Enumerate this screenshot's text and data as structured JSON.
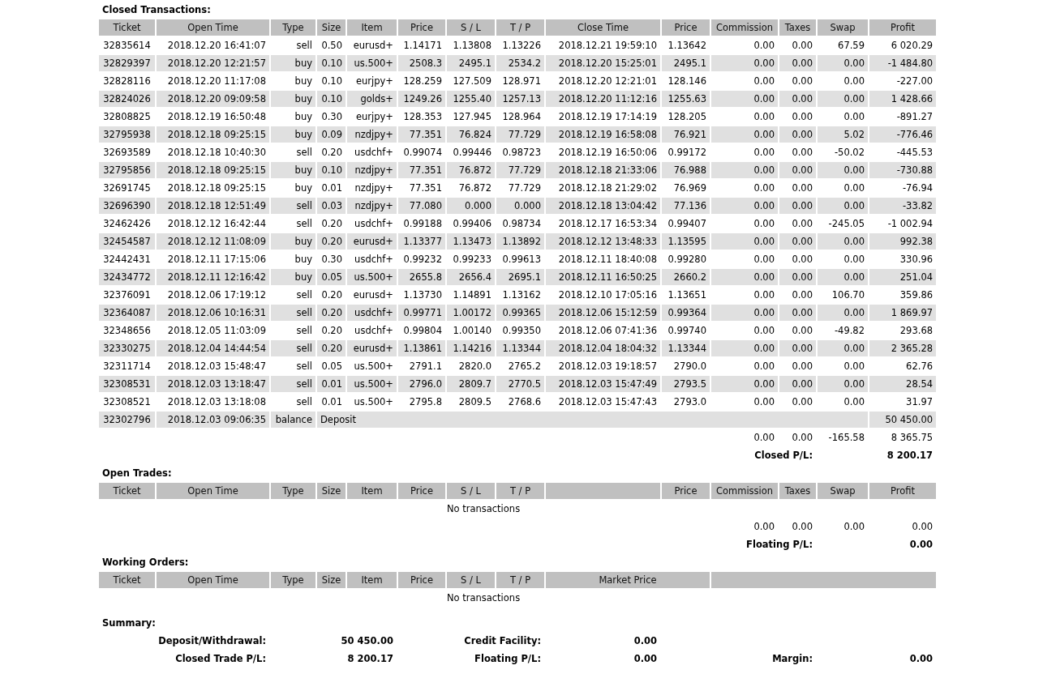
{
  "closed_transactions": {
    "title": "Closed Transactions:",
    "columns": [
      "Ticket",
      "Open Time",
      "Type",
      "Size",
      "Item",
      "Price",
      "S / L",
      "T / P",
      "Close Time",
      "Price",
      "Commission",
      "Taxes",
      "Swap",
      "Profit"
    ],
    "rows": [
      {
        "kind": "trade",
        "cells": [
          "32835614",
          "2018.12.20 16:41:07",
          "sell",
          "0.50",
          "eurusd+",
          "1.14171",
          "1.13808",
          "1.13226",
          "2018.12.21 19:59:10",
          "1.13642",
          "0.00",
          "0.00",
          "67.59",
          "6 020.29"
        ]
      },
      {
        "kind": "trade",
        "cells": [
          "32829397",
          "2018.12.20 12:21:57",
          "buy",
          "0.10",
          "us.500+",
          "2508.3",
          "2495.1",
          "2534.2",
          "2018.12.20 15:25:01",
          "2495.1",
          "0.00",
          "0.00",
          "0.00",
          "-1 484.80"
        ]
      },
      {
        "kind": "trade",
        "cells": [
          "32828116",
          "2018.12.20 11:17:08",
          "buy",
          "0.10",
          "eurjpy+",
          "128.259",
          "127.509",
          "128.971",
          "2018.12.20 12:21:01",
          "128.146",
          "0.00",
          "0.00",
          "0.00",
          "-227.00"
        ]
      },
      {
        "kind": "trade",
        "cells": [
          "32824026",
          "2018.12.20 09:09:58",
          "buy",
          "0.10",
          "golds+",
          "1249.26",
          "1255.40",
          "1257.13",
          "2018.12.20 11:12:16",
          "1255.63",
          "0.00",
          "0.00",
          "0.00",
          "1 428.66"
        ]
      },
      {
        "kind": "trade",
        "cells": [
          "32808825",
          "2018.12.19 16:50:48",
          "buy",
          "0.30",
          "eurjpy+",
          "128.353",
          "127.945",
          "128.964",
          "2018.12.19 17:14:19",
          "128.205",
          "0.00",
          "0.00",
          "0.00",
          "-891.27"
        ]
      },
      {
        "kind": "trade",
        "cells": [
          "32795938",
          "2018.12.18 09:25:15",
          "buy",
          "0.09",
          "nzdjpy+",
          "77.351",
          "76.824",
          "77.729",
          "2018.12.19 16:58:08",
          "76.921",
          "0.00",
          "0.00",
          "5.02",
          "-776.46"
        ]
      },
      {
        "kind": "trade",
        "cells": [
          "32693589",
          "2018.12.18 10:40:30",
          "sell",
          "0.20",
          "usdchf+",
          "0.99074",
          "0.99446",
          "0.98723",
          "2018.12.19 16:50:06",
          "0.99172",
          "0.00",
          "0.00",
          "-50.02",
          "-445.53"
        ]
      },
      {
        "kind": "trade",
        "cells": [
          "32795856",
          "2018.12.18 09:25:15",
          "buy",
          "0.10",
          "nzdjpy+",
          "77.351",
          "76.872",
          "77.729",
          "2018.12.18 21:33:06",
          "76.988",
          "0.00",
          "0.00",
          "0.00",
          "-730.88"
        ]
      },
      {
        "kind": "trade",
        "cells": [
          "32691745",
          "2018.12.18 09:25:15",
          "buy",
          "0.01",
          "nzdjpy+",
          "77.351",
          "76.872",
          "77.729",
          "2018.12.18 21:29:02",
          "76.969",
          "0.00",
          "0.00",
          "0.00",
          "-76.94"
        ]
      },
      {
        "kind": "trade",
        "cells": [
          "32696390",
          "2018.12.18 12:51:49",
          "sell",
          "0.03",
          "nzdjpy+",
          "77.080",
          "0.000",
          "0.000",
          "2018.12.18 13:04:42",
          "77.136",
          "0.00",
          "0.00",
          "0.00",
          "-33.82"
        ]
      },
      {
        "kind": "trade",
        "cells": [
          "32462426",
          "2018.12.12 16:42:44",
          "sell",
          "0.20",
          "usdchf+",
          "0.99188",
          "0.99406",
          "0.98734",
          "2018.12.17 16:53:34",
          "0.99407",
          "0.00",
          "0.00",
          "-245.05",
          "-1 002.94"
        ]
      },
      {
        "kind": "trade",
        "cells": [
          "32454587",
          "2018.12.12 11:08:09",
          "buy",
          "0.20",
          "eurusd+",
          "1.13377",
          "1.13473",
          "1.13892",
          "2018.12.12 13:48:33",
          "1.13595",
          "0.00",
          "0.00",
          "0.00",
          "992.38"
        ]
      },
      {
        "kind": "trade",
        "cells": [
          "32442431",
          "2018.12.11 17:15:06",
          "buy",
          "0.30",
          "usdchf+",
          "0.99232",
          "0.99233",
          "0.99613",
          "2018.12.11 18:40:08",
          "0.99280",
          "0.00",
          "0.00",
          "0.00",
          "330.96"
        ]
      },
      {
        "kind": "trade",
        "cells": [
          "32434772",
          "2018.12.11 12:16:42",
          "buy",
          "0.05",
          "us.500+",
          "2655.8",
          "2656.4",
          "2695.1",
          "2018.12.11 16:50:25",
          "2660.2",
          "0.00",
          "0.00",
          "0.00",
          "251.04"
        ]
      },
      {
        "kind": "trade",
        "cells": [
          "32376091",
          "2018.12.06 17:19:12",
          "sell",
          "0.20",
          "eurusd+",
          "1.13730",
          "1.14891",
          "1.13162",
          "2018.12.10 17:05:16",
          "1.13651",
          "0.00",
          "0.00",
          "106.70",
          "359.86"
        ]
      },
      {
        "kind": "trade",
        "cells": [
          "32364087",
          "2018.12.06 10:16:31",
          "sell",
          "0.20",
          "usdchf+",
          "0.99771",
          "1.00172",
          "0.99365",
          "2018.12.06 15:12:59",
          "0.99364",
          "0.00",
          "0.00",
          "0.00",
          "1 869.97"
        ]
      },
      {
        "kind": "trade",
        "cells": [
          "32348656",
          "2018.12.05 11:03:09",
          "sell",
          "0.20",
          "usdchf+",
          "0.99804",
          "1.00140",
          "0.99350",
          "2018.12.06 07:41:36",
          "0.99740",
          "0.00",
          "0.00",
          "-49.82",
          "293.68"
        ]
      },
      {
        "kind": "trade",
        "cells": [
          "32330275",
          "2018.12.04 14:44:54",
          "sell",
          "0.20",
          "eurusd+",
          "1.13861",
          "1.14216",
          "1.13344",
          "2018.12.04 18:04:32",
          "1.13344",
          "0.00",
          "0.00",
          "0.00",
          "2 365.28"
        ]
      },
      {
        "kind": "trade",
        "cells": [
          "32311714",
          "2018.12.03 15:48:47",
          "sell",
          "0.05",
          "us.500+",
          "2791.1",
          "2820.0",
          "2765.2",
          "2018.12.03 19:18:57",
          "2790.0",
          "0.00",
          "0.00",
          "0.00",
          "62.76"
        ]
      },
      {
        "kind": "trade",
        "cells": [
          "32308531",
          "2018.12.03 13:18:47",
          "sell",
          "0.01",
          "us.500+",
          "2796.0",
          "2809.7",
          "2770.5",
          "2018.12.03 15:47:49",
          "2793.5",
          "0.00",
          "0.00",
          "0.00",
          "28.54"
        ]
      },
      {
        "kind": "trade",
        "cells": [
          "32308521",
          "2018.12.03 13:18:08",
          "sell",
          "0.01",
          "us.500+",
          "2795.8",
          "2809.5",
          "2768.6",
          "2018.12.03 15:47:43",
          "2793.0",
          "0.00",
          "0.00",
          "0.00",
          "31.97"
        ]
      },
      {
        "kind": "balance",
        "cells": [
          {
            "text": "32302796"
          },
          {
            "text": "2018.12.03 09:06:35"
          },
          {
            "text": "balance"
          },
          {
            "text": "Deposit",
            "colspan": 10
          },
          {
            "text": "50 450.00"
          }
        ]
      }
    ],
    "totals": {
      "commission": "0.00",
      "taxes": "0.00",
      "swap": "-165.58",
      "profit": "8 365.75"
    },
    "result": {
      "label": "Closed P/L:",
      "value": "8 200.17"
    }
  },
  "open_trades": {
    "title": "Open Trades:",
    "columns": [
      "Ticket",
      "Open Time",
      "Type",
      "Size",
      "Item",
      "Price",
      "S / L",
      "T / P",
      "Price",
      "Commission",
      "Taxes",
      "Swap",
      "Profit"
    ],
    "empty_message": "No transactions",
    "totals": {
      "commission": "0.00",
      "taxes": "0.00",
      "swap": "0.00",
      "profit": "0.00"
    },
    "result": {
      "label": "Floating P/L:",
      "value": "0.00"
    }
  },
  "working_orders": {
    "title": "Working Orders:",
    "columns": [
      "Ticket",
      "Open Time",
      "Type",
      "Size",
      "Item",
      "Price",
      "S / L",
      "T / P",
      "Market Price"
    ],
    "empty_message": "No transactions"
  },
  "summary": {
    "title": "Summary:",
    "rows": [
      [
        {
          "label": "Deposit/Withdrawal:",
          "value": "50 450.00"
        },
        {
          "label": "Credit Facility:",
          "value": "0.00"
        }
      ],
      [
        {
          "label": "Closed Trade P/L:",
          "value": "8 200.17"
        },
        {
          "label": "Floating P/L:",
          "value": "0.00"
        },
        {
          "label": "Margin:",
          "value": "0.00"
        }
      ]
    ]
  }
}
